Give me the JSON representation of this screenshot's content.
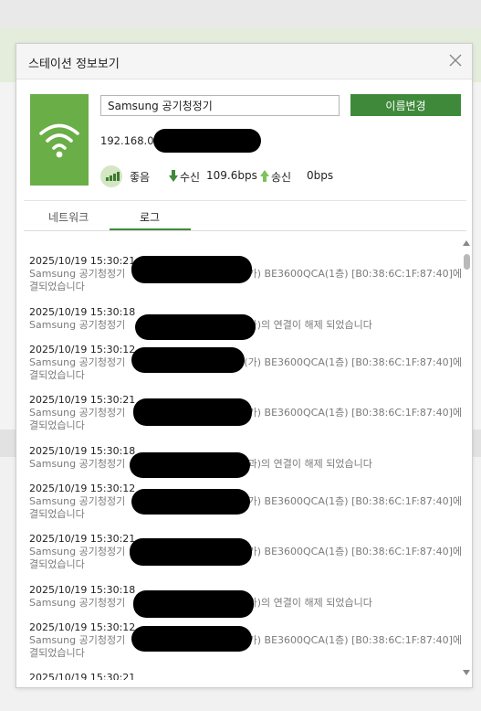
{
  "dialog": {
    "title": "스테이션 정보보기"
  },
  "device": {
    "name": "Samsung 공기청정기",
    "rename_label": "이름변경",
    "ip": "192.168.0.7"
  },
  "status": {
    "signal_label": "좋음",
    "rx_label": "수신",
    "rx_value": "109.6bps",
    "tx_label": "송신",
    "tx_value": "0bps"
  },
  "tabs": [
    {
      "label": "네트워크",
      "selected": false
    },
    {
      "label": "로그",
      "selected": true
    }
  ],
  "log": [
    {
      "time": "2025/10/19 15:30:21",
      "pre": "Samsung 공기청정기",
      "post": "이(가) BE3600QCA(1층) [B0:38:6C:1F:87:40]에 연",
      "line2": "결되었습니다"
    },
    {
      "time": "2025/10/19 15:30:18",
      "pre": "Samsung 공기청정기",
      "post": "와(과)의 연결이 해제 되었습니다",
      "line2": ""
    },
    {
      "time": "2025/10/19 15:30:12",
      "pre": "Samsung 공기청정기",
      "post": "이(가) BE3600QCA(1층) [B0:38:6C:1F:87:40]에 연",
      "line2": "결되었습니다"
    },
    {
      "time": "2025/10/19 15:30:21",
      "pre": "Samsung 공기청정기",
      "post": "이(가) BE3600QCA(1층) [B0:38:6C:1F:87:40]에 연",
      "line2": "결되었습니다"
    },
    {
      "time": "2025/10/19 15:30:18",
      "pre": "Samsung 공기청정기",
      "post": "와(과)의 연결이 해제 되었습니다",
      "line2": ""
    },
    {
      "time": "2025/10/19 15:30:12",
      "pre": "Samsung 공기청정기",
      "post": "이(가) BE3600QCA(1층) [B0:38:6C:1F:87:40]에 연",
      "line2": "결되었습니다"
    },
    {
      "time": "2025/10/19 15:30:21",
      "pre": "Samsung 공기청정기",
      "post": "이(가) BE3600QCA(1층) [B0:38:6C:1F:87:40]에 연",
      "line2": "결되었습니다"
    },
    {
      "time": "2025/10/19 15:30:18",
      "pre": "Samsung 공기청정기",
      "post": "와(과)의 연결이 해제 되었습니다",
      "line2": ""
    },
    {
      "time": "2025/10/19 15:30:12",
      "pre": "Samsung 공기청정기",
      "post": "이(가) BE3600QCA(1층) [B0:38:6C:1F:87:40]에 연",
      "line2": "결되었습니다"
    },
    {
      "time": "2025/10/19 15:30:21",
      "pre": "",
      "post": "",
      "line2": ""
    }
  ],
  "colors": {
    "accent": "#3f8a3a",
    "tile": "#6aae47",
    "log_message": "#7b7b7b"
  },
  "icons": [
    "wifi-icon",
    "signal-icon",
    "download-arrow-icon",
    "upload-arrow-icon",
    "close-icon"
  ]
}
